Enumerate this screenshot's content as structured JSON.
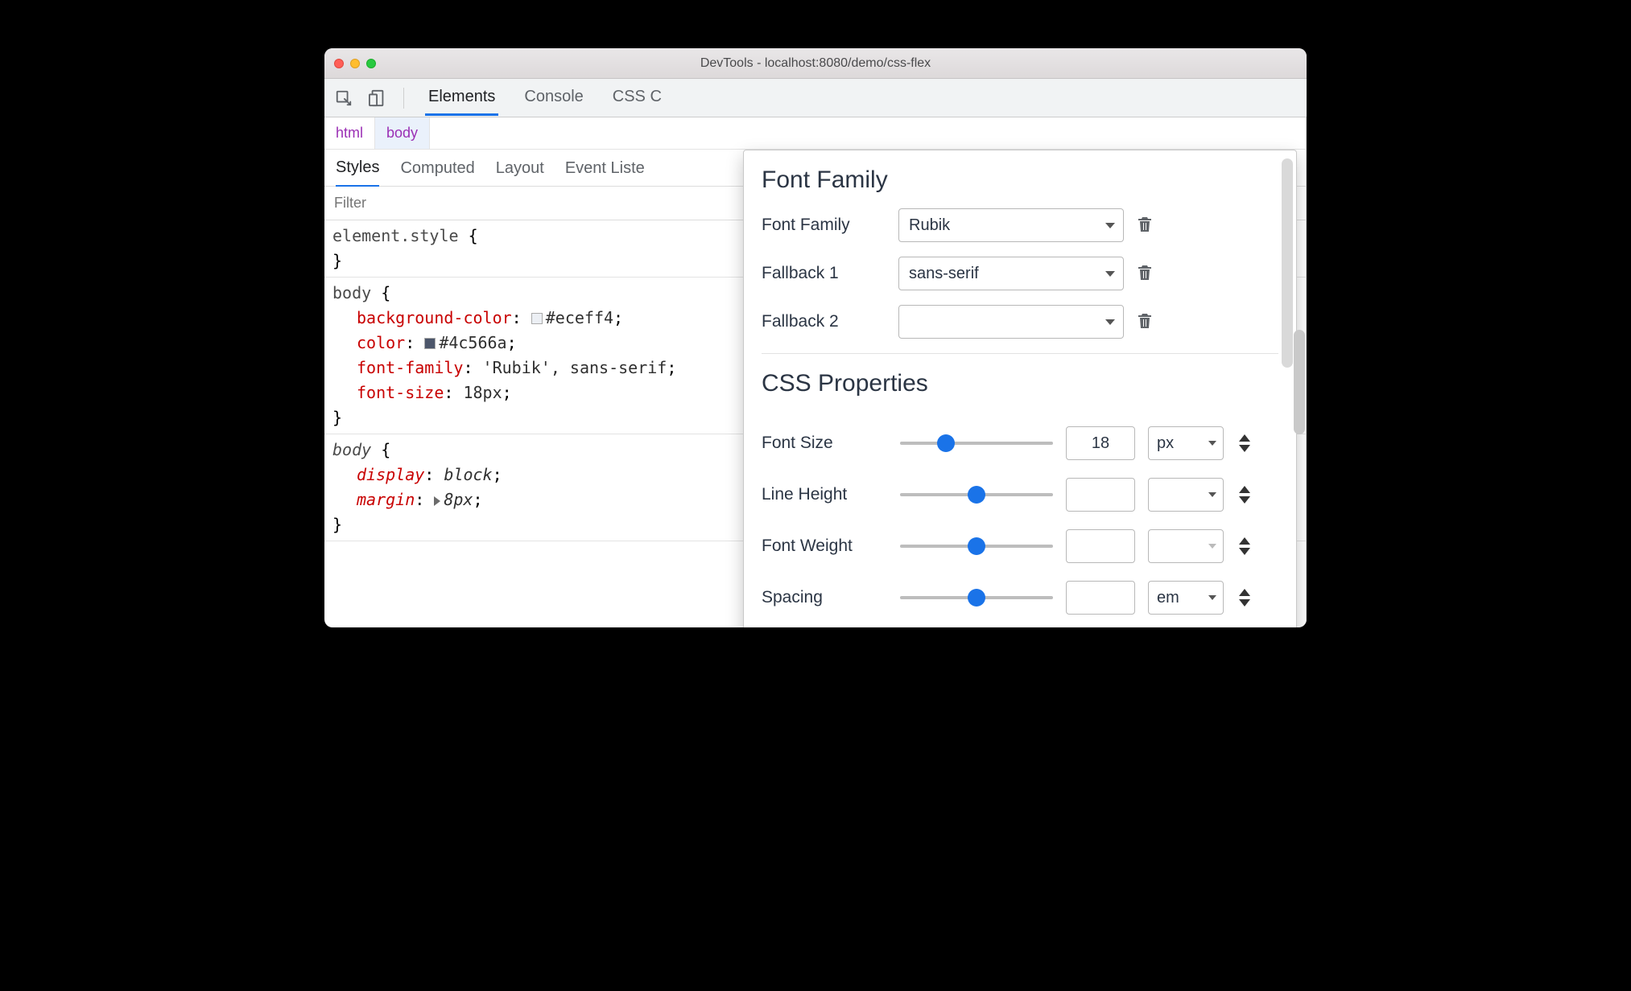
{
  "window": {
    "title": "DevTools - localhost:8080/demo/css-flex"
  },
  "tabs": {
    "elements": "Elements",
    "console": "Console",
    "css_cut": "CSS C"
  },
  "breadcrumb": {
    "html": "html",
    "body": "body"
  },
  "subtabs": {
    "styles": "Styles",
    "computed": "Computed",
    "layout": "Layout",
    "event_listeners_cut": "Event Liste"
  },
  "filter": {
    "placeholder": "Filter"
  },
  "rules": {
    "element_style": {
      "sel": "element.style",
      "open": "{",
      "close": "}"
    },
    "body1": {
      "sel": "body",
      "open": "{",
      "close": "}",
      "props": {
        "bg": {
          "name": "background-color",
          "value": "#eceff4",
          "swatch": "#eceff4"
        },
        "color": {
          "name": "color",
          "value": "#4c566a",
          "swatch": "#4c566a"
        },
        "ff": {
          "name": "font-family",
          "value": "'Rubik', sans-serif"
        },
        "fs": {
          "name": "font-size",
          "value": "18px"
        }
      }
    },
    "body2": {
      "sel": "body",
      "open": "{",
      "close": "}",
      "props": {
        "display": {
          "name": "display",
          "value": "block"
        },
        "margin": {
          "name": "margin",
          "value": "8px"
        }
      }
    }
  },
  "popover": {
    "font_family_heading": "Font Family",
    "rows": {
      "font_family": {
        "label": "Font Family",
        "value": "Rubik"
      },
      "fallback1": {
        "label": "Fallback 1",
        "value": "sans-serif"
      },
      "fallback2": {
        "label": "Fallback 2",
        "value": ""
      }
    },
    "css_props_heading": "CSS Properties",
    "props": {
      "font_size": {
        "label": "Font Size",
        "value": "18",
        "unit": "px",
        "thumb_pct": 30
      },
      "line_height": {
        "label": "Line Height",
        "value": "",
        "unit": "",
        "thumb_pct": 50
      },
      "font_weight": {
        "label": "Font Weight",
        "value": "",
        "unit": "",
        "thumb_pct": 50,
        "unit_disabled": true
      },
      "spacing": {
        "label": "Spacing",
        "value": "",
        "unit": "em",
        "thumb_pct": 50
      }
    }
  }
}
